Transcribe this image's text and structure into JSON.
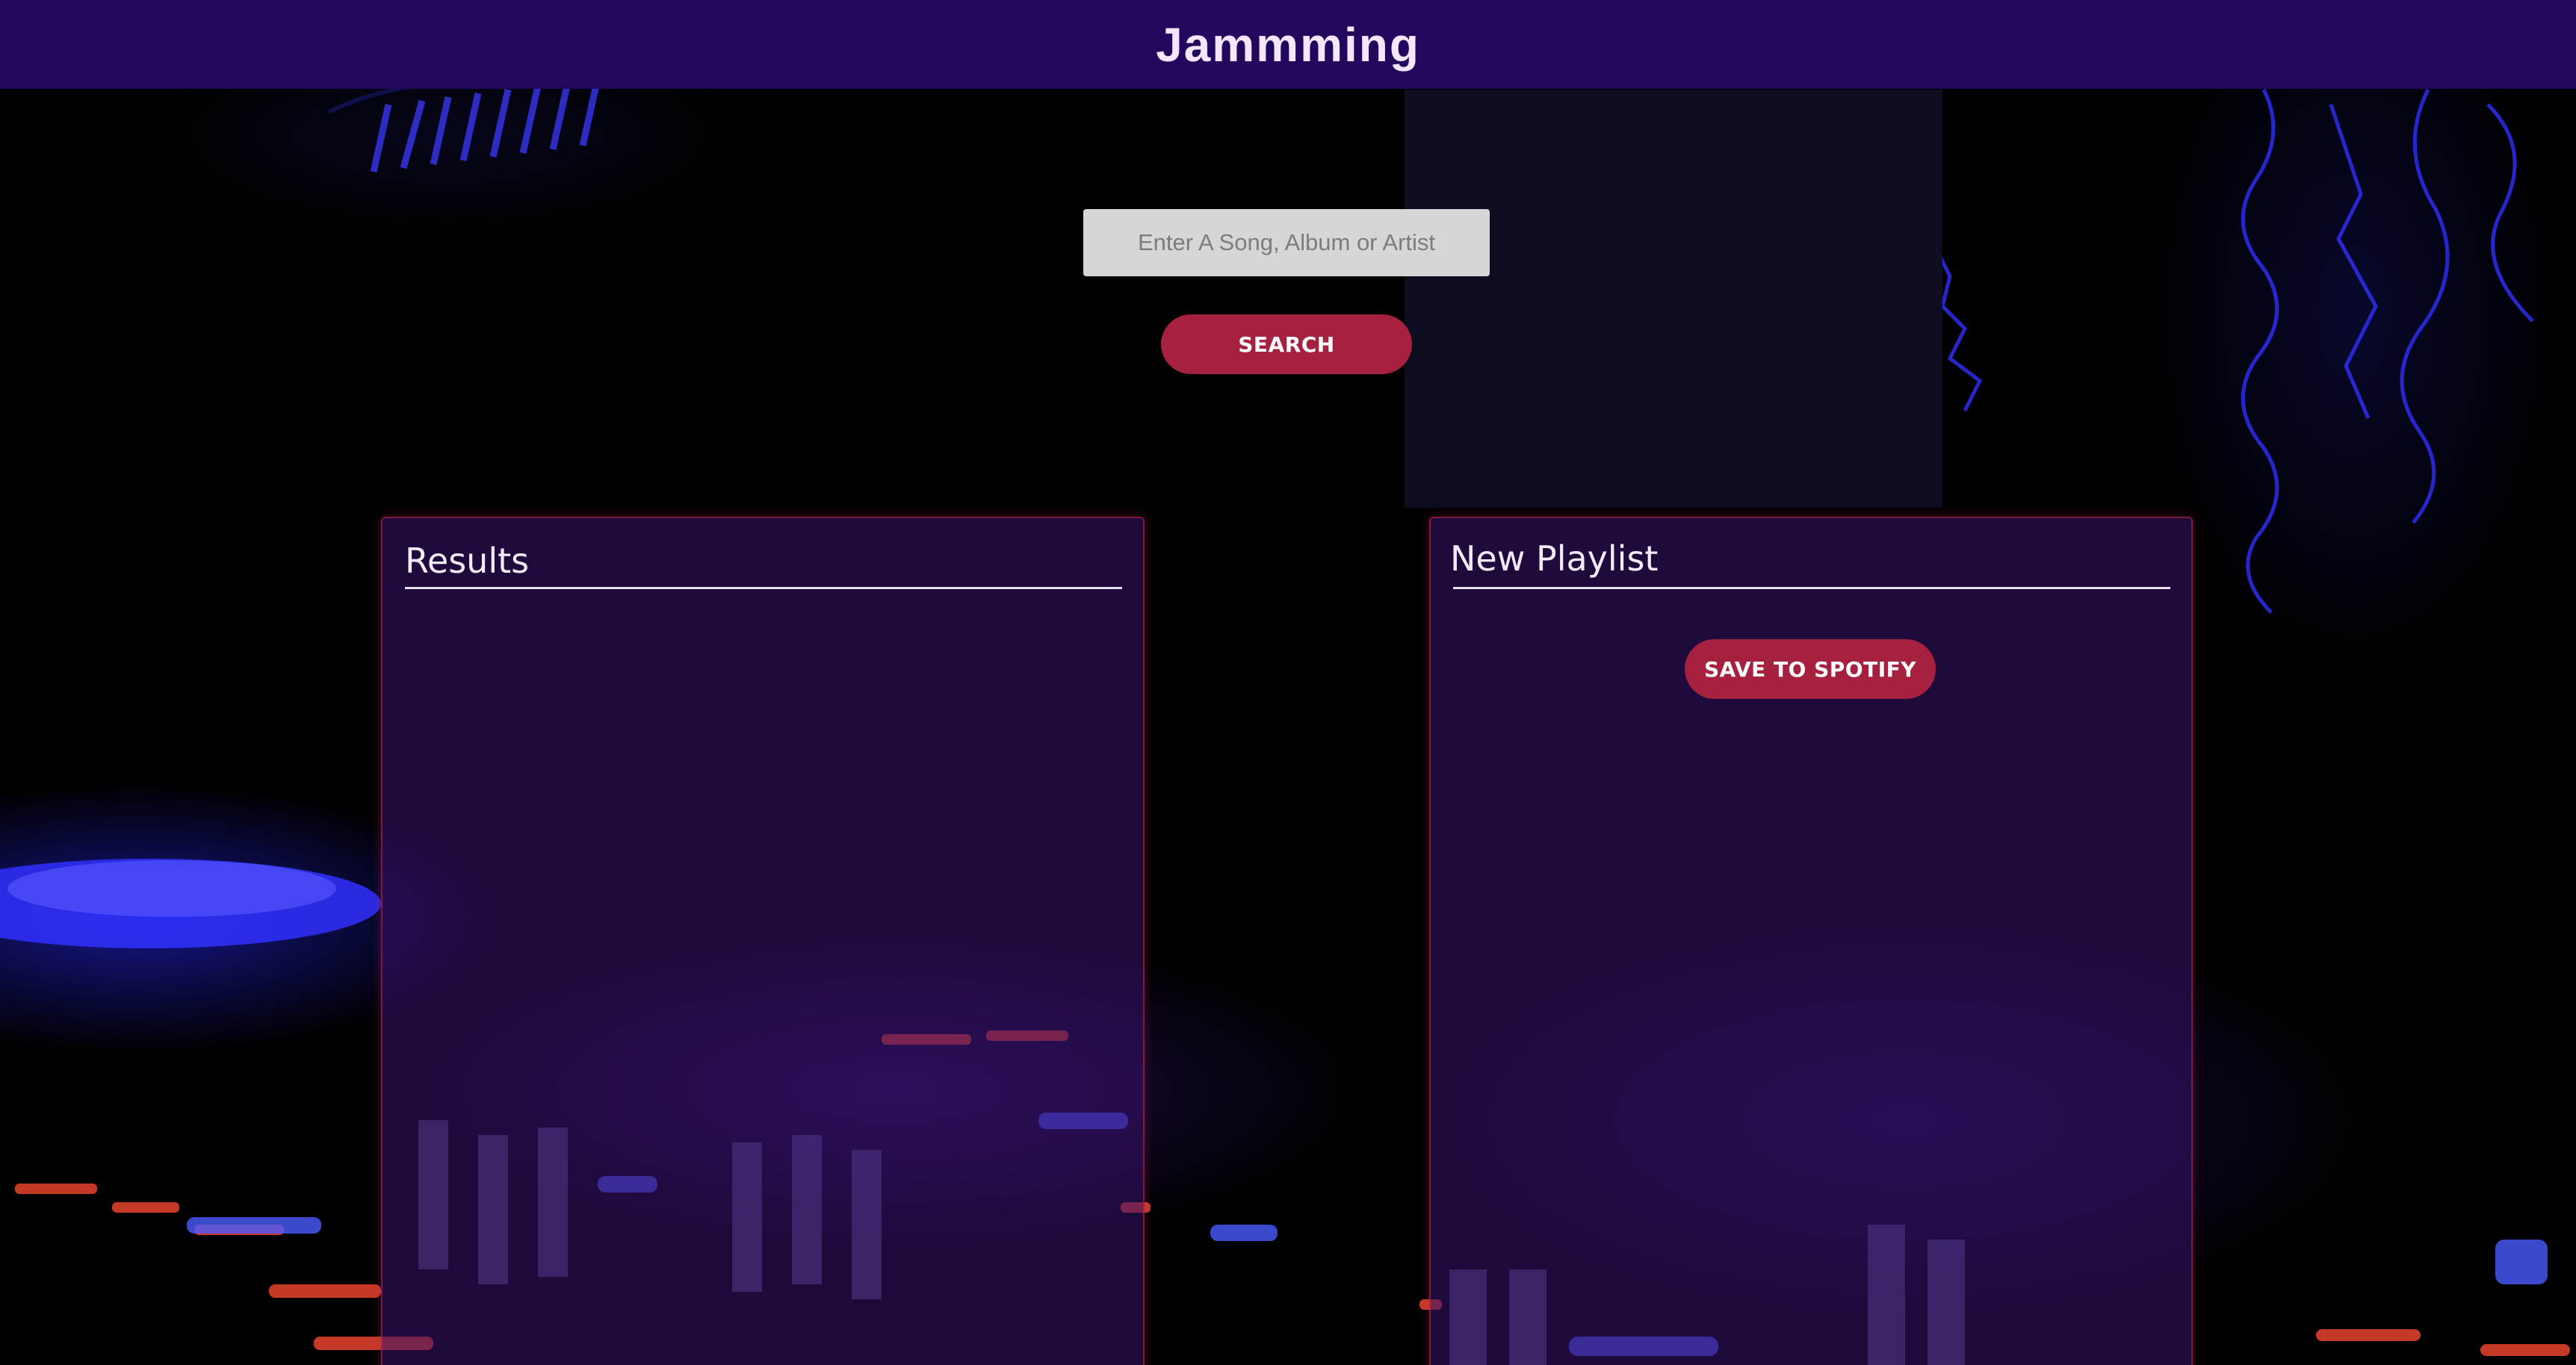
{
  "header": {
    "title": "Jammming"
  },
  "search": {
    "placeholder": "Enter A Song, Album or Artist",
    "value": "",
    "button_label": "SEARCH"
  },
  "results": {
    "title": "Results",
    "tracks": []
  },
  "playlist": {
    "name": "New Playlist",
    "save_label": "SAVE TO SPOTIFY",
    "tracks": []
  },
  "colors": {
    "header_bg": "#22075c",
    "accent_button": "#a6213f",
    "panel_bg": "#38126e"
  }
}
